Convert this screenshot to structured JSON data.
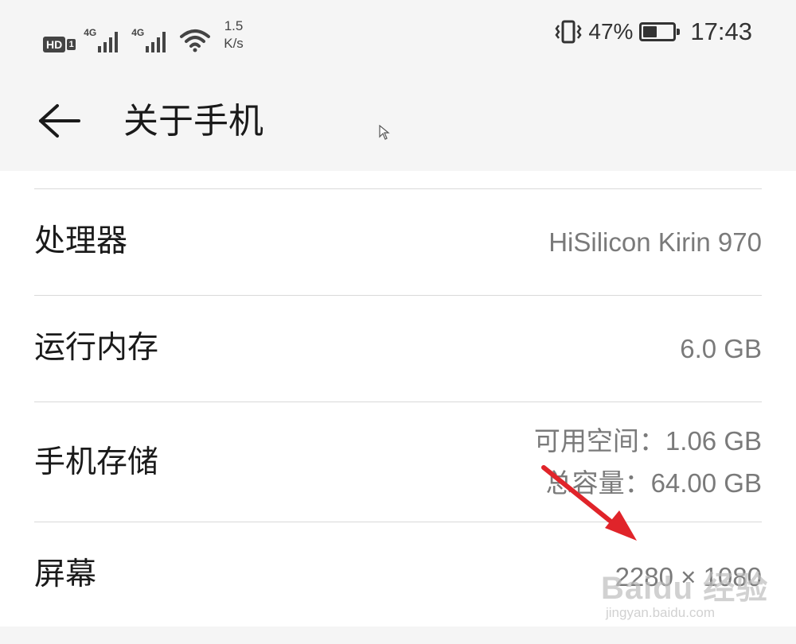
{
  "status_bar": {
    "hd_label": "HD",
    "hd_sim": "1",
    "network_1": "4G",
    "network_2": "4G",
    "speed_value": "1.5",
    "speed_unit": "K/s",
    "battery_percent": "47%",
    "battery_level": 0.47,
    "time": "17:43",
    "icons": [
      "hd-voice-icon",
      "signal-icon",
      "signal-icon",
      "wifi-icon",
      "vibrate-icon",
      "battery-icon"
    ]
  },
  "app_bar": {
    "title": "关于手机",
    "back_icon": "back-arrow-icon"
  },
  "rows": [
    {
      "label": "处理器",
      "value": "HiSilicon Kirin 970"
    },
    {
      "label": "运行内存",
      "value": "6.0 GB"
    },
    {
      "label": "手机存储",
      "value_line1": "可用空间：1.06  GB",
      "value_line2": "总容量：64.00  GB"
    },
    {
      "label": "屏幕",
      "value": "2280 × 1080"
    }
  ],
  "watermark": {
    "brand": "Baidu 经验",
    "url": "jingyan.baidu.com"
  },
  "colors": {
    "accent_arrow": "#e0242a",
    "text_primary": "#1a1a1a",
    "text_secondary": "#7a7a7a",
    "divider": "#d9d9d9",
    "background": "#f5f5f5"
  }
}
